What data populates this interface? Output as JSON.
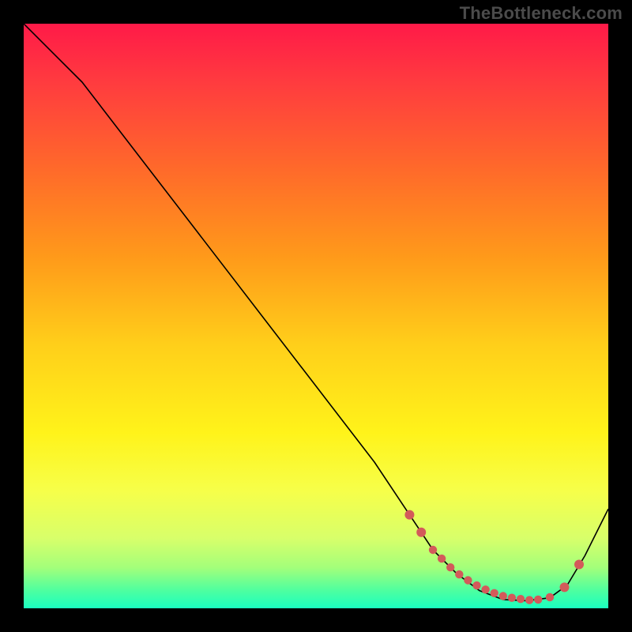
{
  "watermark": "TheBottleneck.com",
  "colors": {
    "dot": "#d35a5a",
    "curve": "#000000",
    "frame_bg": "#000000"
  },
  "gradient_stops": [
    {
      "offset": 0.0,
      "color": "#ff1a48"
    },
    {
      "offset": 0.1,
      "color": "#ff3b3f"
    },
    {
      "offset": 0.25,
      "color": "#ff6a2a"
    },
    {
      "offset": 0.4,
      "color": "#ff9a1a"
    },
    {
      "offset": 0.55,
      "color": "#ffcf1a"
    },
    {
      "offset": 0.7,
      "color": "#fff31a"
    },
    {
      "offset": 0.8,
      "color": "#f6ff4a"
    },
    {
      "offset": 0.88,
      "color": "#d8ff6a"
    },
    {
      "offset": 0.93,
      "color": "#a4ff7a"
    },
    {
      "offset": 0.97,
      "color": "#4dffa0"
    },
    {
      "offset": 1.0,
      "color": "#1affc0"
    }
  ],
  "chart_data": {
    "type": "line",
    "title": "",
    "xlabel": "",
    "ylabel": "",
    "xlim": [
      0,
      100
    ],
    "ylim": [
      0,
      100
    ],
    "series": [
      {
        "name": "bottleneck-curve",
        "x": [
          0,
          6,
          10,
          20,
          30,
          40,
          50,
          60,
          66,
          70,
          74,
          78,
          82,
          86,
          90,
          93,
          96,
          100
        ],
        "y": [
          100,
          94,
          90,
          77,
          64,
          51,
          38,
          25,
          16,
          10,
          6,
          3,
          1.5,
          1.3,
          1.8,
          4,
          9,
          17
        ]
      }
    ],
    "markers": {
      "name": "highlighted-range",
      "x": [
        66,
        68,
        70,
        71.5,
        73,
        74.5,
        76,
        77.5,
        79,
        80.5,
        82,
        83.5,
        85,
        86.5,
        88,
        90,
        92.5,
        95
      ],
      "y": [
        16,
        13,
        10,
        8.5,
        7,
        5.8,
        4.8,
        3.9,
        3.2,
        2.6,
        2.1,
        1.8,
        1.6,
        1.4,
        1.5,
        1.9,
        3.6,
        7.5
      ]
    }
  }
}
